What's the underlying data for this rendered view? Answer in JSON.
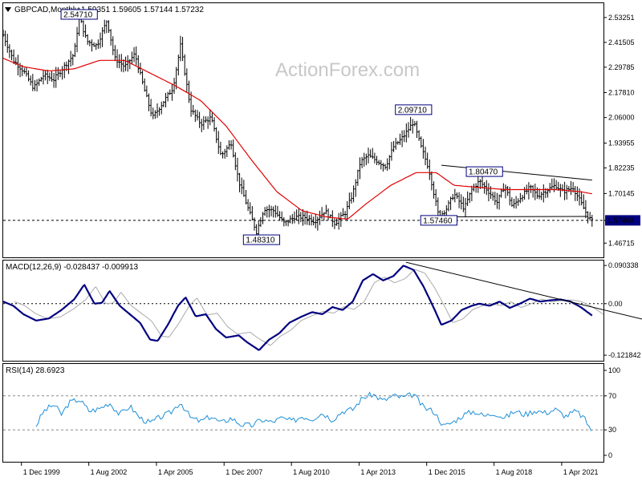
{
  "window": {
    "symbol_header": "GBPCAD,Monthly",
    "ohlc_header": "1.59351 1.59605 1.57144 1.57232",
    "watermark": "ActionForex.com"
  },
  "colors": {
    "price": "#000000",
    "ma": "#e00000",
    "macd": "#000080",
    "signal": "#aaaaaa",
    "rsi": "#1e8fd8",
    "label_border": "#000080",
    "current_box": "#000080"
  },
  "chart_data": [
    {
      "type": "bar",
      "name_id": "price",
      "ylim": [
        1.4,
        2.6
      ],
      "y_ticks": [
        "2.53251",
        "2.41505",
        "2.29785",
        "2.17810",
        "2.06000",
        "1.93955",
        "1.82235",
        "1.70145",
        "1.57460",
        "1.46715"
      ],
      "x_tick_labels": [
        "1 Dec 1999",
        "1 Aug 2002",
        "1 Apr 2005",
        "1 Dec 2007",
        "1 Aug 2010",
        "1 Apr 2013",
        "1 Dec 2015",
        "1 Aug 2018",
        "1 Apr 2021"
      ],
      "x_tick_years": [
        1999.92,
        2002.58,
        2005.25,
        2007.92,
        2010.58,
        2013.25,
        2015.92,
        2018.58,
        2021.25
      ],
      "x_range": [
        1999.2,
        2022.9
      ],
      "close_anchors": [
        [
          1999.2,
          2.45
        ],
        [
          1999.6,
          2.33
        ],
        [
          2000.0,
          2.28
        ],
        [
          2000.4,
          2.2
        ],
        [
          2000.8,
          2.26
        ],
        [
          2001.2,
          2.24
        ],
        [
          2001.6,
          2.3
        ],
        [
          2002.0,
          2.36
        ],
        [
          2002.2,
          2.54
        ],
        [
          2002.5,
          2.42
        ],
        [
          2002.9,
          2.4
        ],
        [
          2003.3,
          2.52
        ],
        [
          2003.6,
          2.34
        ],
        [
          2004.0,
          2.3
        ],
        [
          2004.4,
          2.36
        ],
        [
          2004.8,
          2.18
        ],
        [
          2005.1,
          2.06
        ],
        [
          2005.5,
          2.13
        ],
        [
          2005.9,
          2.2
        ],
        [
          2006.2,
          2.4
        ],
        [
          2006.6,
          2.1
        ],
        [
          2007.0,
          2.03
        ],
        [
          2007.4,
          2.06
        ],
        [
          2007.8,
          1.88
        ],
        [
          2008.2,
          1.94
        ],
        [
          2008.5,
          1.76
        ],
        [
          2008.9,
          1.62
        ],
        [
          2009.2,
          1.52
        ],
        [
          2009.5,
          1.63
        ],
        [
          2009.9,
          1.62
        ],
        [
          2010.3,
          1.56
        ],
        [
          2010.7,
          1.59
        ],
        [
          2011.1,
          1.59
        ],
        [
          2011.5,
          1.57
        ],
        [
          2011.9,
          1.62
        ],
        [
          2012.3,
          1.56
        ],
        [
          2012.7,
          1.61
        ],
        [
          2013.0,
          1.7
        ],
        [
          2013.3,
          1.85
        ],
        [
          2013.6,
          1.88
        ],
        [
          2013.9,
          1.86
        ],
        [
          2014.3,
          1.83
        ],
        [
          2014.6,
          1.92
        ],
        [
          2015.0,
          1.97
        ],
        [
          2015.4,
          2.04
        ],
        [
          2015.7,
          1.92
        ],
        [
          2016.0,
          1.82
        ],
        [
          2016.4,
          1.59
        ],
        [
          2016.7,
          1.63
        ],
        [
          2017.0,
          1.7
        ],
        [
          2017.4,
          1.63
        ],
        [
          2017.7,
          1.72
        ],
        [
          2018.0,
          1.76
        ],
        [
          2018.3,
          1.72
        ],
        [
          2018.7,
          1.66
        ],
        [
          2019.0,
          1.74
        ],
        [
          2019.3,
          1.64
        ],
        [
          2019.6,
          1.68
        ],
        [
          2020.0,
          1.73
        ],
        [
          2020.3,
          1.69
        ],
        [
          2020.7,
          1.72
        ],
        [
          2021.0,
          1.74
        ],
        [
          2021.3,
          1.71
        ],
        [
          2021.7,
          1.73
        ],
        [
          2022.0,
          1.66
        ],
        [
          2022.3,
          1.59
        ],
        [
          2022.45,
          1.572
        ]
      ],
      "ma_anchors": [
        [
          1999.2,
          2.34
        ],
        [
          2000.0,
          2.3
        ],
        [
          2001.0,
          2.28
        ],
        [
          2002.0,
          2.29
        ],
        [
          2003.0,
          2.33
        ],
        [
          2004.0,
          2.33
        ],
        [
          2005.0,
          2.27
        ],
        [
          2006.0,
          2.21
        ],
        [
          2007.0,
          2.14
        ],
        [
          2008.0,
          2.02
        ],
        [
          2009.0,
          1.86
        ],
        [
          2010.0,
          1.71
        ],
        [
          2011.0,
          1.62
        ],
        [
          2012.0,
          1.59
        ],
        [
          2012.8,
          1.58
        ],
        [
          2013.5,
          1.65
        ],
        [
          2014.5,
          1.74
        ],
        [
          2015.5,
          1.8
        ],
        [
          2016.3,
          1.8
        ],
        [
          2017.0,
          1.74
        ],
        [
          2018.0,
          1.73
        ],
        [
          2019.0,
          1.72
        ],
        [
          2020.0,
          1.72
        ],
        [
          2021.0,
          1.72
        ],
        [
          2022.0,
          1.71
        ],
        [
          2022.45,
          1.7
        ]
      ],
      "annotations": [
        {
          "text": "2.54710",
          "x": 2002.2,
          "y": 2.5471
        },
        {
          "text": "2.09710",
          "x": 2015.4,
          "y": 2.0971
        },
        {
          "text": "1.80470",
          "x": 2018.2,
          "y": 1.8047
        },
        {
          "text": "1.57460",
          "x": 2016.4,
          "y": 1.5746
        },
        {
          "text": "1.48310",
          "x": 2009.4,
          "y": 1.4831
        }
      ],
      "trendlines": [
        [
          [
            2016.5,
            1.835
          ],
          [
            2022.45,
            1.765
          ]
        ],
        [
          [
            2016.3,
            1.591
          ],
          [
            2022.3,
            1.593
          ]
        ]
      ],
      "current_level": {
        "value": 1.5746,
        "label": "1.57460"
      }
    },
    {
      "type": "line",
      "name_id": "macd",
      "title": "MACD(12,26,9) -0.028437 -0.009913",
      "ylim": [
        -0.135,
        0.102
      ],
      "y_ticks": [
        "0.090338",
        "0.00",
        "-0.121842"
      ],
      "zero_line": 0.0,
      "macd_anchors": [
        [
          1999.2,
          0.005
        ],
        [
          1999.6,
          -0.005
        ],
        [
          2000.0,
          -0.025
        ],
        [
          2000.5,
          -0.04
        ],
        [
          2001.0,
          -0.035
        ],
        [
          2001.5,
          -0.015
        ],
        [
          2002.0,
          0.01
        ],
        [
          2002.4,
          0.045
        ],
        [
          2002.8,
          0.0
        ],
        [
          2003.1,
          0.002
        ],
        [
          2003.4,
          0.03
        ],
        [
          2003.8,
          -0.005
        ],
        [
          2004.2,
          -0.025
        ],
        [
          2004.6,
          -0.045
        ],
        [
          2005.0,
          -0.085
        ],
        [
          2005.3,
          -0.088
        ],
        [
          2005.7,
          -0.05
        ],
        [
          2006.1,
          -0.005
        ],
        [
          2006.4,
          0.015
        ],
        [
          2006.8,
          -0.03
        ],
        [
          2007.2,
          -0.025
        ],
        [
          2007.6,
          -0.06
        ],
        [
          2008.0,
          -0.08
        ],
        [
          2008.5,
          -0.075
        ],
        [
          2008.8,
          -0.09
        ],
        [
          2009.3,
          -0.11
        ],
        [
          2009.7,
          -0.085
        ],
        [
          2010.1,
          -0.07
        ],
        [
          2010.5,
          -0.045
        ],
        [
          2011.0,
          -0.03
        ],
        [
          2011.4,
          -0.02
        ],
        [
          2011.8,
          -0.025
        ],
        [
          2012.2,
          -0.008
        ],
        [
          2012.6,
          -0.015
        ],
        [
          2013.0,
          0.005
        ],
        [
          2013.4,
          0.055
        ],
        [
          2013.8,
          0.07
        ],
        [
          2014.2,
          0.055
        ],
        [
          2014.6,
          0.065
        ],
        [
          2015.0,
          0.09
        ],
        [
          2015.4,
          0.08
        ],
        [
          2015.8,
          0.04
        ],
        [
          2016.2,
          -0.01
        ],
        [
          2016.5,
          -0.05
        ],
        [
          2016.9,
          -0.04
        ],
        [
          2017.3,
          -0.015
        ],
        [
          2017.7,
          -0.005
        ],
        [
          2018.0,
          0.0
        ],
        [
          2018.4,
          -0.005
        ],
        [
          2018.8,
          0.005
        ],
        [
          2019.2,
          -0.01
        ],
        [
          2019.6,
          0.0
        ],
        [
          2020.0,
          0.012
        ],
        [
          2020.4,
          0.005
        ],
        [
          2020.8,
          0.008
        ],
        [
          2021.2,
          0.01
        ],
        [
          2021.6,
          0.005
        ],
        [
          2022.0,
          -0.008
        ],
        [
          2022.45,
          -0.028
        ]
      ],
      "trendline": [
        [
          2015.1,
          0.098
        ],
        [
          2025.5,
          -0.052
        ]
      ]
    },
    {
      "type": "line",
      "name_id": "rsi",
      "title": "RSI(14) 28.6923",
      "ylim": [
        0,
        100
      ],
      "y_ticks": [
        "100",
        "70",
        "30",
        "0"
      ],
      "levels": [
        70,
        30
      ],
      "rsi_anchors": [
        [
          2000.5,
          35
        ],
        [
          2000.8,
          52
        ],
        [
          2001.2,
          60
        ],
        [
          2001.5,
          48
        ],
        [
          2001.8,
          62
        ],
        [
          2002.2,
          66
        ],
        [
          2002.6,
          52
        ],
        [
          2003.0,
          55
        ],
        [
          2003.4,
          62
        ],
        [
          2003.8,
          48
        ],
        [
          2004.2,
          58
        ],
        [
          2004.6,
          44
        ],
        [
          2005.0,
          38
        ],
        [
          2005.4,
          45
        ],
        [
          2005.8,
          50
        ],
        [
          2006.2,
          63
        ],
        [
          2006.6,
          44
        ],
        [
          2007.0,
          40
        ],
        [
          2007.4,
          46
        ],
        [
          2007.8,
          38
        ],
        [
          2008.2,
          44
        ],
        [
          2008.6,
          36
        ],
        [
          2009.0,
          35
        ],
        [
          2009.4,
          42
        ],
        [
          2009.8,
          39
        ],
        [
          2010.2,
          44
        ],
        [
          2010.6,
          40
        ],
        [
          2011.0,
          46
        ],
        [
          2011.4,
          43
        ],
        [
          2011.8,
          50
        ],
        [
          2012.2,
          42
        ],
        [
          2012.6,
          52
        ],
        [
          2013.0,
          54
        ],
        [
          2013.4,
          68
        ],
        [
          2013.8,
          72
        ],
        [
          2014.2,
          64
        ],
        [
          2014.6,
          70
        ],
        [
          2015.0,
          68
        ],
        [
          2015.4,
          72
        ],
        [
          2015.8,
          56
        ],
        [
          2016.2,
          52
        ],
        [
          2016.6,
          34
        ],
        [
          2017.0,
          40
        ],
        [
          2017.4,
          48
        ],
        [
          2017.8,
          52
        ],
        [
          2018.2,
          46
        ],
        [
          2018.6,
          50
        ],
        [
          2019.0,
          44
        ],
        [
          2019.4,
          52
        ],
        [
          2019.8,
          48
        ],
        [
          2020.2,
          53
        ],
        [
          2020.6,
          50
        ],
        [
          2021.0,
          54
        ],
        [
          2021.4,
          46
        ],
        [
          2021.8,
          52
        ],
        [
          2022.1,
          45
        ],
        [
          2022.45,
          28.7
        ]
      ]
    }
  ]
}
